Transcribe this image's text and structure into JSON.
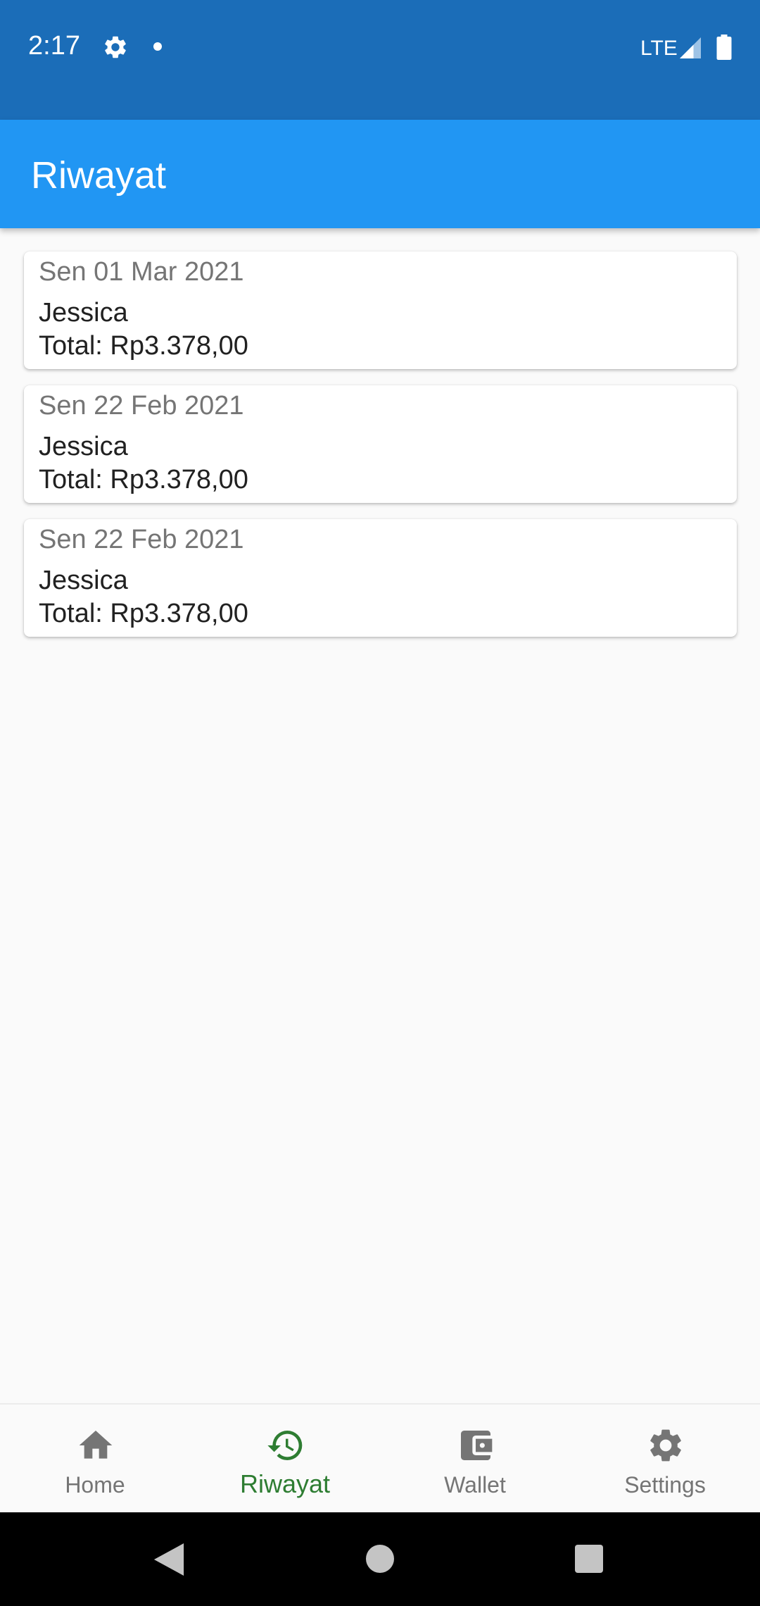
{
  "status_bar": {
    "time": "2:17",
    "network": "LTE",
    "icons": [
      "gear-icon",
      "notification-dot",
      "signal-icon",
      "battery-icon"
    ]
  },
  "app_bar": {
    "title": "Riwayat"
  },
  "history": [
    {
      "date": "Sen 01 Mar 2021",
      "name": "Jessica",
      "total": "Total: Rp3.378,00"
    },
    {
      "date": "Sen 22 Feb 2021",
      "name": "Jessica",
      "total": "Total: Rp3.378,00"
    },
    {
      "date": "Sen 22 Feb 2021",
      "name": "Jessica",
      "total": "Total: Rp3.378,00"
    }
  ],
  "bottom_nav": {
    "active": "Riwayat",
    "items": [
      {
        "label": "Home",
        "icon": "home-icon"
      },
      {
        "label": "Riwayat",
        "icon": "history-icon"
      },
      {
        "label": "Wallet",
        "icon": "wallet-icon"
      },
      {
        "label": "Settings",
        "icon": "settings-icon"
      }
    ]
  },
  "colors": {
    "status_bar": "#1b6db8",
    "app_bar": "#2196f3",
    "active_tab": "#2e7d32",
    "inactive_tab": "#757575"
  }
}
